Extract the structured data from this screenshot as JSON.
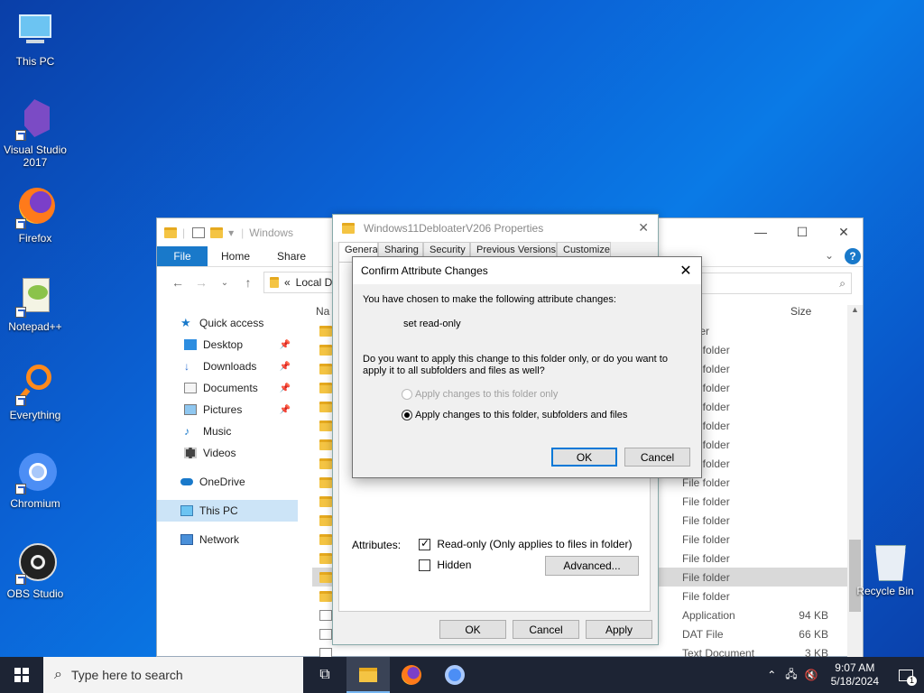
{
  "desktop": {
    "icons": [
      {
        "label": "This PC",
        "icon": "monitor-icon"
      },
      {
        "label": "Visual Studio 2017",
        "icon": "visual-studio-icon"
      },
      {
        "label": "Firefox",
        "icon": "firefox-icon"
      },
      {
        "label": "Notepad++",
        "icon": "notepadpp-icon"
      },
      {
        "label": "Everything",
        "icon": "everything-icon"
      },
      {
        "label": "Chromium",
        "icon": "chromium-icon"
      },
      {
        "label": "OBS Studio",
        "icon": "obs-icon"
      }
    ],
    "recycle_bin": "Recycle Bin",
    "background": "#0b63d6"
  },
  "explorer": {
    "title": "Windows",
    "ribbon_tabs": {
      "file": "File",
      "home": "Home",
      "share": "Share",
      "view": "V"
    },
    "address": "Local Disk",
    "sidebar": {
      "quick_access": "Quick access",
      "desktop": "Desktop",
      "downloads": "Downloads",
      "documents": "Documents",
      "pictures": "Pictures",
      "music": "Music",
      "videos": "Videos",
      "onedrive": "OneDrive",
      "this_pc": "This PC",
      "network": "Network"
    },
    "columns": {
      "name": "Na",
      "size": "Size"
    },
    "rows": [
      {
        "type": "folder",
        "size": ""
      },
      {
        "type": "File folder",
        "size": ""
      },
      {
        "type": "File folder",
        "size": ""
      },
      {
        "type": "File folder",
        "size": ""
      },
      {
        "type": "File folder",
        "size": ""
      },
      {
        "type": "File folder",
        "size": ""
      },
      {
        "type": "File folder",
        "size": ""
      },
      {
        "type": "File folder",
        "size": ""
      },
      {
        "type": "File folder",
        "size": ""
      },
      {
        "type": "File folder",
        "size": ""
      },
      {
        "type": "File folder",
        "size": ""
      },
      {
        "type": "File folder",
        "size": ""
      },
      {
        "type": "File folder",
        "size": ""
      },
      {
        "type": "File folder",
        "size": ""
      },
      {
        "type": "File folder",
        "size": ""
      },
      {
        "type": "Application",
        "size": "94 KB"
      },
      {
        "type": "DAT File",
        "size": "66 KB"
      },
      {
        "type": "Text Document",
        "size": "3 KB"
      }
    ]
  },
  "properties": {
    "title": "Windows11DebloaterV206 Properties",
    "tabs": [
      "General",
      "Sharing",
      "Security",
      "Previous Versions",
      "Customize"
    ],
    "attributes_label": "Attributes:",
    "readonly_label": "Read-only (Only applies to files in folder)",
    "hidden_label": "Hidden",
    "advanced_button": "Advanced...",
    "ok": "OK",
    "cancel": "Cancel",
    "apply": "Apply"
  },
  "confirm": {
    "title": "Confirm Attribute Changes",
    "intro": "You have chosen to make the following attribute changes:",
    "change": "set read-only",
    "question_line1": "Do you want to apply this change to this folder only, or do you want to",
    "question_line2": "apply it to all subfolders and files as well?",
    "option_folder_only": "Apply changes to this folder only",
    "option_all": "Apply changes to this folder, subfolders and files",
    "ok": "OK",
    "cancel": "Cancel"
  },
  "taskbar": {
    "search_placeholder": "Type here to search",
    "time": "9:07 AM",
    "date": "5/18/2024",
    "notification_count": "1"
  }
}
